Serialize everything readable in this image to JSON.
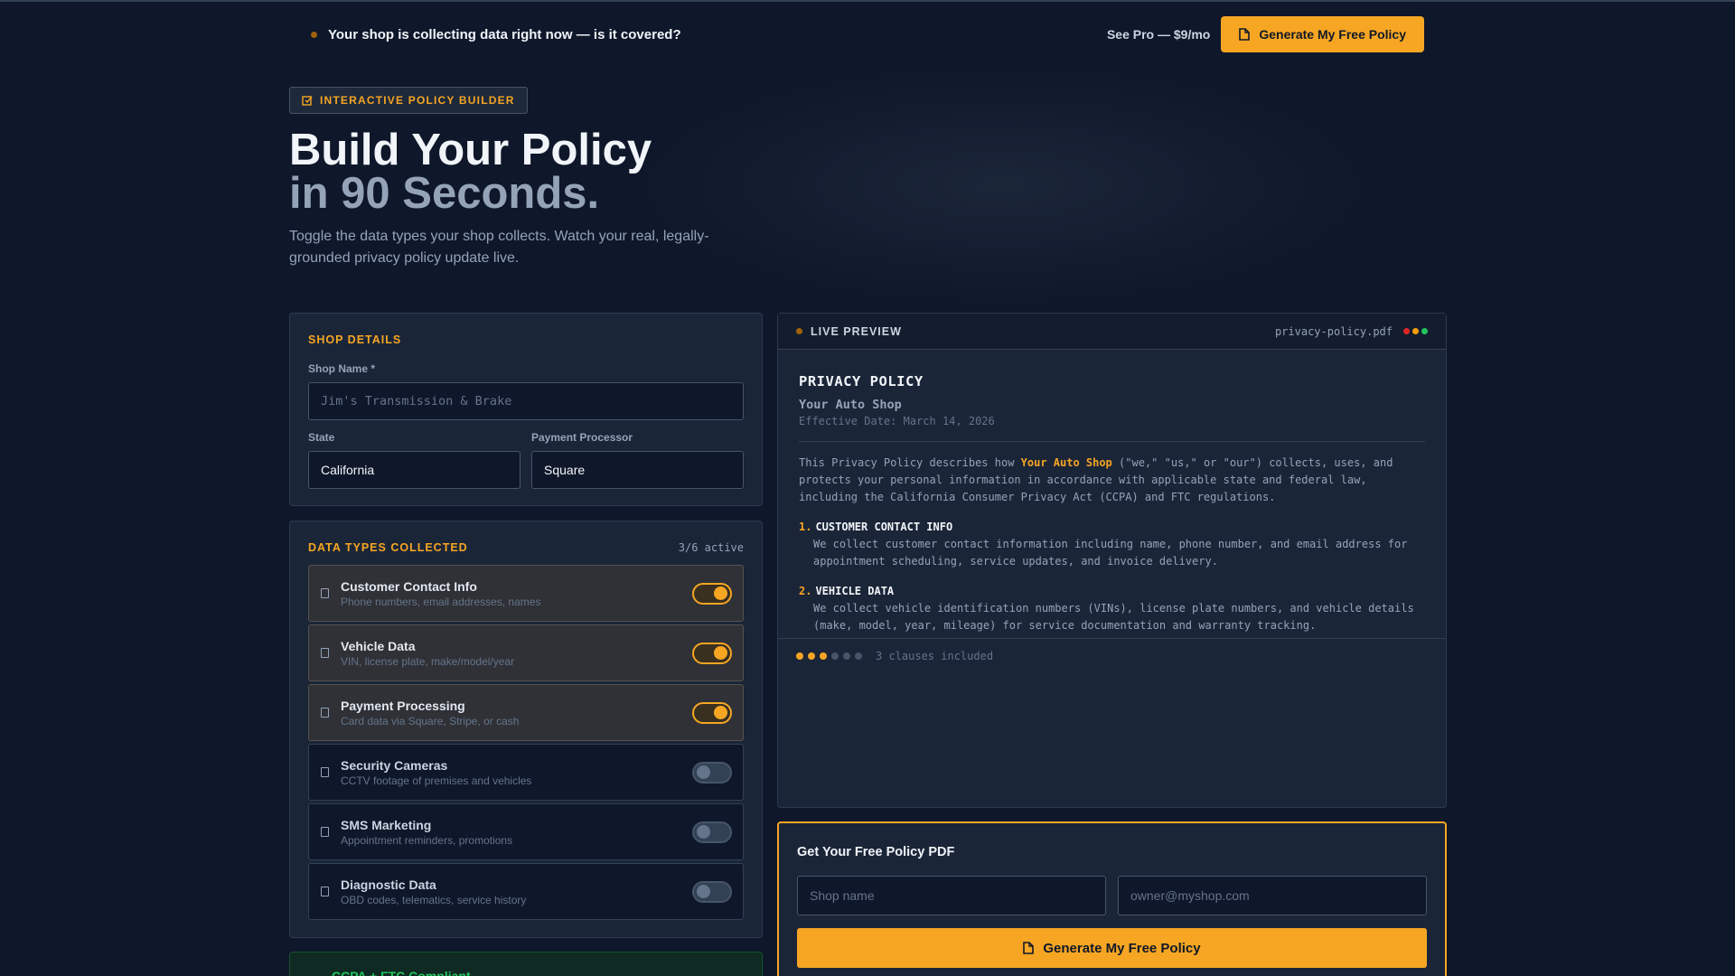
{
  "announcement": {
    "message": "Your shop is collecting data right now — is it covered?",
    "see_pro": "See Pro — $9/mo",
    "cta": "Generate My Free Policy"
  },
  "hero": {
    "badge": "INTERACTIVE POLICY BUILDER",
    "title_line1": "Build Your Policy",
    "title_line2": "in 90 Seconds.",
    "subtitle": "Toggle the data types your shop collects. Watch your real, legally-grounded privacy policy update live."
  },
  "shop_details": {
    "heading": "SHOP DETAILS",
    "shop_name_label": "Shop Name *",
    "shop_name_placeholder": "Jim's Transmission & Brake",
    "state_label": "State",
    "state_value": "California",
    "processor_label": "Payment Processor",
    "processor_value": "Square"
  },
  "data_types": {
    "heading": "DATA TYPES COLLECTED",
    "active_count": "3/6 active",
    "items": [
      {
        "title": "Customer Contact Info",
        "desc": "Phone numbers, email addresses, names",
        "enabled": true
      },
      {
        "title": "Vehicle Data",
        "desc": "VIN, license plate, make/model/year",
        "enabled": true
      },
      {
        "title": "Payment Processing",
        "desc": "Card data via Square, Stripe, or cash",
        "enabled": true
      },
      {
        "title": "Security Cameras",
        "desc": "CCTV footage of premises and vehicles",
        "enabled": false
      },
      {
        "title": "SMS Marketing",
        "desc": "Appointment reminders, promotions",
        "enabled": false
      },
      {
        "title": "Diagnostic Data",
        "desc": "OBD codes, telematics, service history",
        "enabled": false
      }
    ]
  },
  "compliance": {
    "label": "CCPA + FTC Compliant"
  },
  "preview": {
    "heading": "LIVE PREVIEW",
    "filename": "privacy-policy.pdf",
    "window_dots": [
      "#dc2626",
      "#f59e0b",
      "#22c55e"
    ],
    "doc_title": "PRIVACY POLICY",
    "shop": "Your Auto Shop",
    "effective_date": "Effective Date: March 14, 2026",
    "intro_before": "This Privacy Policy describes how ",
    "intro_highlight": "Your Auto Shop",
    "intro_after": " (\"we,\" \"us,\" or \"our\") collects, uses, and protects your personal information in accordance with applicable state and federal law, including the California Consumer Privacy Act (CCPA) and FTC regulations.",
    "clauses": [
      {
        "num": "1.",
        "title": "CUSTOMER CONTACT INFO",
        "body": "We collect customer contact information including name, phone number, and email address for appointment scheduling, service updates, and invoice delivery."
      },
      {
        "num": "2.",
        "title": "VEHICLE DATA",
        "body": "We collect vehicle identification numbers (VINs), license plate numbers, and vehicle details (make, model, year, mileage) for service documentation and warranty tracking."
      }
    ],
    "progress_total": 6,
    "progress_on": 3,
    "clauses_included": "3 clauses included"
  },
  "lead_form": {
    "title": "Get Your Free Policy PDF",
    "shop_placeholder": "Shop name",
    "email_placeholder": "owner@myshop.com",
    "button": "Generate My Free Policy"
  },
  "colors": {
    "accent": "#f6a623",
    "background": "#0f172a",
    "panel": "#1b2538",
    "success": "#22c55e"
  }
}
